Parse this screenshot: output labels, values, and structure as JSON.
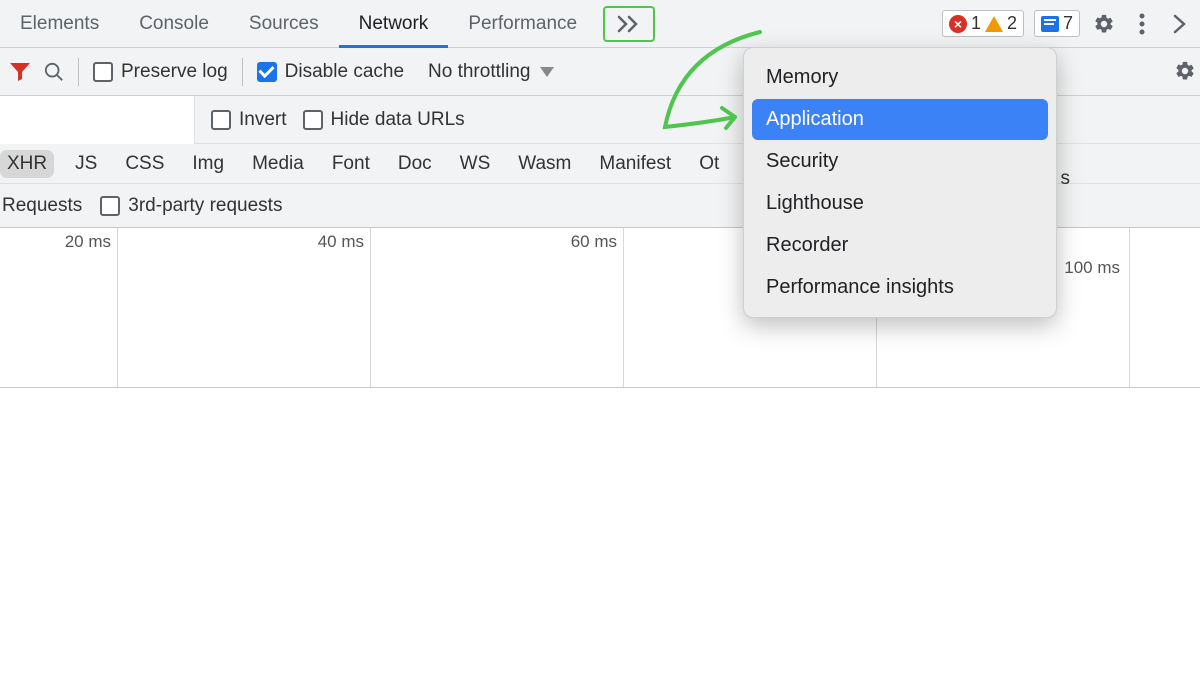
{
  "tabs": {
    "elements": "Elements",
    "console": "Console",
    "sources": "Sources",
    "network": "Network",
    "performance": "Performance",
    "activeTab": "network"
  },
  "badges": {
    "errors": "1",
    "warnings": "2",
    "messages": "7"
  },
  "toolbar": {
    "preserve_log": "Preserve log",
    "disable_cache": "Disable cache",
    "throttling": "No throttling"
  },
  "filter_row": {
    "invert": "Invert",
    "hide_data_urls": "Hide data URLs"
  },
  "types": {
    "xhr": "XHR",
    "js": "JS",
    "css": "CSS",
    "img": "Img",
    "media": "Media",
    "font": "Font",
    "doc": "Doc",
    "ws": "WS",
    "wasm": "Wasm",
    "manifest": "Manifest",
    "other": "Ot"
  },
  "req_row": {
    "requests": "Requests",
    "third_party": "3rd-party requests"
  },
  "timeline": {
    "labels": [
      "20 ms",
      "40 ms",
      "60 ms",
      "100 ms"
    ]
  },
  "overflow_menu": {
    "memory": "Memory",
    "application": "Application",
    "security": "Security",
    "lighthouse": "Lighthouse",
    "recorder": "Recorder",
    "perf_insights": "Performance insights"
  },
  "misc": {
    "trailing_s": "s"
  }
}
